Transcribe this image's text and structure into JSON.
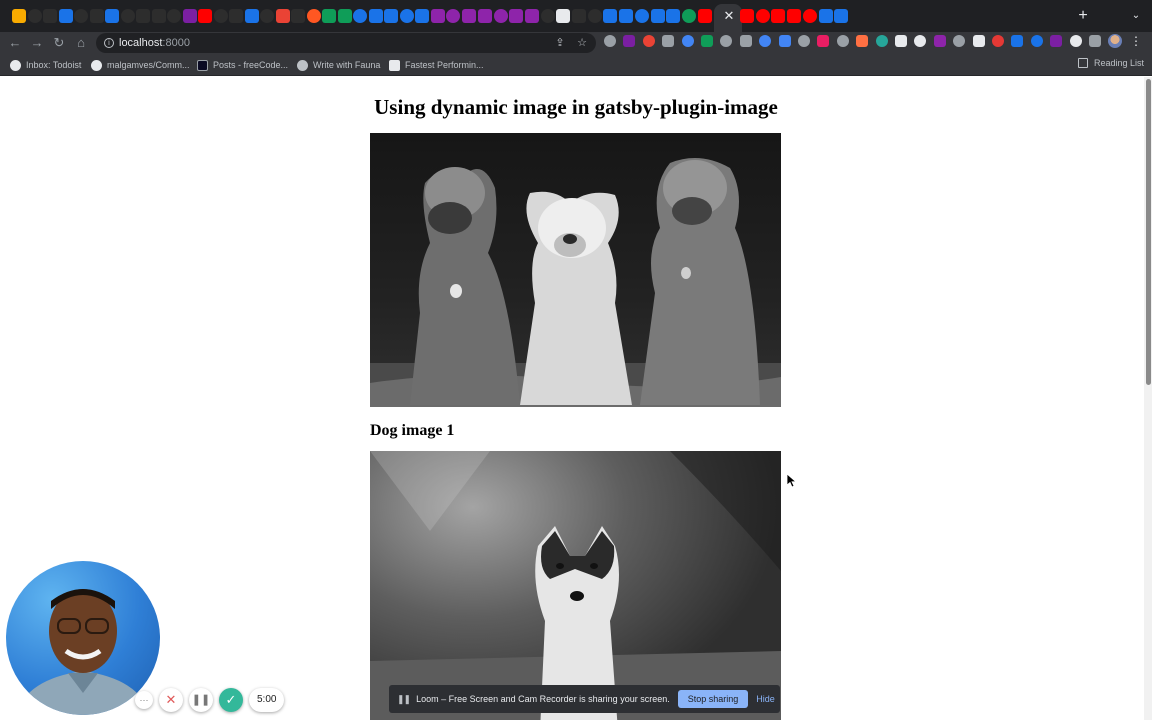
{
  "tabs": {
    "close_glyph": "✕",
    "new_tab_glyph": "+",
    "menu_glyph": "⌄",
    "favicon_colors": [
      "#f9ab00",
      "#2d2d2d",
      "#2d2d2d",
      "#1a73e8",
      "#2d2d2d",
      "#2d2d2d",
      "#1a73e8",
      "#2d2d2d",
      "#2d2d2d",
      "#2d2d2d",
      "#2d2d2d",
      "#7b1fa2",
      "#ff0000",
      "#2d2d2d",
      "#2d2d2d",
      "#1a73e8",
      "#2d2d2d",
      "#ea4335",
      "#2d2d2d",
      "#ff5722",
      "#0f9d58",
      "#0f9d58",
      "#1a73e8",
      "#1a73e8",
      "#1a73e8",
      "#1a73e8",
      "#1a73e8",
      "#8e24aa",
      "#8e24aa",
      "#8e24aa",
      "#8e24aa",
      "#8e24aa",
      "#8e24aa",
      "#8e24aa",
      "#2d2d2d",
      "#e8eaed",
      "#2d2d2d",
      "#2d2d2d",
      "#1a73e8",
      "#1a73e8",
      "#1a73e8",
      "#1a73e8",
      "#1a73e8",
      "#0f9d58",
      "#ff0000",
      "#ff0000",
      "#ff0000",
      "#ff0000",
      "#ff0000",
      "#ff0000",
      "#1a73e8",
      "#1a73e8"
    ]
  },
  "toolbar": {
    "back_glyph": "←",
    "forward_glyph": "→",
    "reload_glyph": "↻",
    "home_glyph": "⌂",
    "url_host": "localhost",
    "url_port": ":8000",
    "share_glyph": "⇪",
    "star_glyph": "☆",
    "kebab_glyph": "⋮",
    "extension_colors": [
      "#9aa0a6",
      "#7b1fa2",
      "#ea4335",
      "#9aa0a6",
      "#4285f4",
      "#0f9d58",
      "#9aa0a6",
      "#9aa0a6",
      "#4285f4",
      "#4285f4",
      "#9aa0a6",
      "#e91e63",
      "#9aa0a6",
      "#ff7043",
      "#26a69a",
      "#e8eaed",
      "#e8eaed",
      "#8e24aa",
      "#9aa0a6",
      "#e8eaed",
      "#e53935",
      "#1a73e8",
      "#1a73e8",
      "#7b1fa2",
      "#e8eaed",
      "#9aa0a6"
    ]
  },
  "bookmarks": {
    "items": [
      {
        "label": "Inbox: Todoist",
        "icon": "todoist-icon"
      },
      {
        "label": "malgamves/Comm...",
        "icon": "github-icon"
      },
      {
        "label": "Posts - freeCode...",
        "icon": "freecodecamp-icon"
      },
      {
        "label": "Write with Fauna",
        "icon": "globe-icon"
      },
      {
        "label": "Fastest Performin...",
        "icon": "bookmark-icon"
      }
    ],
    "reading_list": "Reading List"
  },
  "page": {
    "title": "Using dynamic image in gatsby-plugin-image",
    "caption_1": "Dog image 1"
  },
  "loom": {
    "more_glyph": "···",
    "cancel_glyph": "✕",
    "pause_glyph": "❚❚",
    "done_glyph": "✓",
    "timer": "5:00"
  },
  "share_bar": {
    "pause_glyph": "❚❚",
    "message": "Loom – Free Screen and Cam Recorder is sharing your screen.",
    "stop_label": "Stop sharing",
    "hide_label": "Hide"
  }
}
